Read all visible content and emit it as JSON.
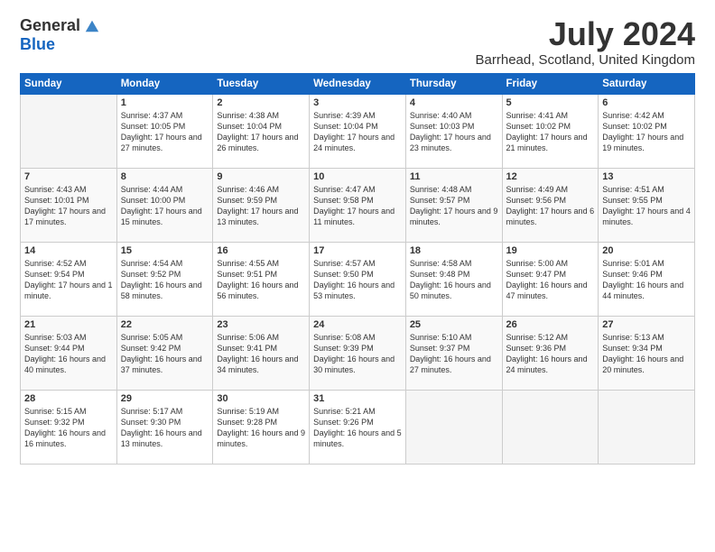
{
  "logo": {
    "general": "General",
    "blue": "Blue"
  },
  "title": "July 2024",
  "location": "Barrhead, Scotland, United Kingdom",
  "days_of_week": [
    "Sunday",
    "Monday",
    "Tuesday",
    "Wednesday",
    "Thursday",
    "Friday",
    "Saturday"
  ],
  "weeks": [
    [
      {
        "day": "",
        "sunrise": "",
        "sunset": "",
        "daylight": ""
      },
      {
        "day": "1",
        "sunrise": "Sunrise: 4:37 AM",
        "sunset": "Sunset: 10:05 PM",
        "daylight": "Daylight: 17 hours and 27 minutes."
      },
      {
        "day": "2",
        "sunrise": "Sunrise: 4:38 AM",
        "sunset": "Sunset: 10:04 PM",
        "daylight": "Daylight: 17 hours and 26 minutes."
      },
      {
        "day": "3",
        "sunrise": "Sunrise: 4:39 AM",
        "sunset": "Sunset: 10:04 PM",
        "daylight": "Daylight: 17 hours and 24 minutes."
      },
      {
        "day": "4",
        "sunrise": "Sunrise: 4:40 AM",
        "sunset": "Sunset: 10:03 PM",
        "daylight": "Daylight: 17 hours and 23 minutes."
      },
      {
        "day": "5",
        "sunrise": "Sunrise: 4:41 AM",
        "sunset": "Sunset: 10:02 PM",
        "daylight": "Daylight: 17 hours and 21 minutes."
      },
      {
        "day": "6",
        "sunrise": "Sunrise: 4:42 AM",
        "sunset": "Sunset: 10:02 PM",
        "daylight": "Daylight: 17 hours and 19 minutes."
      }
    ],
    [
      {
        "day": "7",
        "sunrise": "Sunrise: 4:43 AM",
        "sunset": "Sunset: 10:01 PM",
        "daylight": "Daylight: 17 hours and 17 minutes."
      },
      {
        "day": "8",
        "sunrise": "Sunrise: 4:44 AM",
        "sunset": "Sunset: 10:00 PM",
        "daylight": "Daylight: 17 hours and 15 minutes."
      },
      {
        "day": "9",
        "sunrise": "Sunrise: 4:46 AM",
        "sunset": "Sunset: 9:59 PM",
        "daylight": "Daylight: 17 hours and 13 minutes."
      },
      {
        "day": "10",
        "sunrise": "Sunrise: 4:47 AM",
        "sunset": "Sunset: 9:58 PM",
        "daylight": "Daylight: 17 hours and 11 minutes."
      },
      {
        "day": "11",
        "sunrise": "Sunrise: 4:48 AM",
        "sunset": "Sunset: 9:57 PM",
        "daylight": "Daylight: 17 hours and 9 minutes."
      },
      {
        "day": "12",
        "sunrise": "Sunrise: 4:49 AM",
        "sunset": "Sunset: 9:56 PM",
        "daylight": "Daylight: 17 hours and 6 minutes."
      },
      {
        "day": "13",
        "sunrise": "Sunrise: 4:51 AM",
        "sunset": "Sunset: 9:55 PM",
        "daylight": "Daylight: 17 hours and 4 minutes."
      }
    ],
    [
      {
        "day": "14",
        "sunrise": "Sunrise: 4:52 AM",
        "sunset": "Sunset: 9:54 PM",
        "daylight": "Daylight: 17 hours and 1 minute."
      },
      {
        "day": "15",
        "sunrise": "Sunrise: 4:54 AM",
        "sunset": "Sunset: 9:52 PM",
        "daylight": "Daylight: 16 hours and 58 minutes."
      },
      {
        "day": "16",
        "sunrise": "Sunrise: 4:55 AM",
        "sunset": "Sunset: 9:51 PM",
        "daylight": "Daylight: 16 hours and 56 minutes."
      },
      {
        "day": "17",
        "sunrise": "Sunrise: 4:57 AM",
        "sunset": "Sunset: 9:50 PM",
        "daylight": "Daylight: 16 hours and 53 minutes."
      },
      {
        "day": "18",
        "sunrise": "Sunrise: 4:58 AM",
        "sunset": "Sunset: 9:48 PM",
        "daylight": "Daylight: 16 hours and 50 minutes."
      },
      {
        "day": "19",
        "sunrise": "Sunrise: 5:00 AM",
        "sunset": "Sunset: 9:47 PM",
        "daylight": "Daylight: 16 hours and 47 minutes."
      },
      {
        "day": "20",
        "sunrise": "Sunrise: 5:01 AM",
        "sunset": "Sunset: 9:46 PM",
        "daylight": "Daylight: 16 hours and 44 minutes."
      }
    ],
    [
      {
        "day": "21",
        "sunrise": "Sunrise: 5:03 AM",
        "sunset": "Sunset: 9:44 PM",
        "daylight": "Daylight: 16 hours and 40 minutes."
      },
      {
        "day": "22",
        "sunrise": "Sunrise: 5:05 AM",
        "sunset": "Sunset: 9:42 PM",
        "daylight": "Daylight: 16 hours and 37 minutes."
      },
      {
        "day": "23",
        "sunrise": "Sunrise: 5:06 AM",
        "sunset": "Sunset: 9:41 PM",
        "daylight": "Daylight: 16 hours and 34 minutes."
      },
      {
        "day": "24",
        "sunrise": "Sunrise: 5:08 AM",
        "sunset": "Sunset: 9:39 PM",
        "daylight": "Daylight: 16 hours and 30 minutes."
      },
      {
        "day": "25",
        "sunrise": "Sunrise: 5:10 AM",
        "sunset": "Sunset: 9:37 PM",
        "daylight": "Daylight: 16 hours and 27 minutes."
      },
      {
        "day": "26",
        "sunrise": "Sunrise: 5:12 AM",
        "sunset": "Sunset: 9:36 PM",
        "daylight": "Daylight: 16 hours and 24 minutes."
      },
      {
        "day": "27",
        "sunrise": "Sunrise: 5:13 AM",
        "sunset": "Sunset: 9:34 PM",
        "daylight": "Daylight: 16 hours and 20 minutes."
      }
    ],
    [
      {
        "day": "28",
        "sunrise": "Sunrise: 5:15 AM",
        "sunset": "Sunset: 9:32 PM",
        "daylight": "Daylight: 16 hours and 16 minutes."
      },
      {
        "day": "29",
        "sunrise": "Sunrise: 5:17 AM",
        "sunset": "Sunset: 9:30 PM",
        "daylight": "Daylight: 16 hours and 13 minutes."
      },
      {
        "day": "30",
        "sunrise": "Sunrise: 5:19 AM",
        "sunset": "Sunset: 9:28 PM",
        "daylight": "Daylight: 16 hours and 9 minutes."
      },
      {
        "day": "31",
        "sunrise": "Sunrise: 5:21 AM",
        "sunset": "Sunset: 9:26 PM",
        "daylight": "Daylight: 16 hours and 5 minutes."
      },
      {
        "day": "",
        "sunrise": "",
        "sunset": "",
        "daylight": ""
      },
      {
        "day": "",
        "sunrise": "",
        "sunset": "",
        "daylight": ""
      },
      {
        "day": "",
        "sunrise": "",
        "sunset": "",
        "daylight": ""
      }
    ]
  ]
}
